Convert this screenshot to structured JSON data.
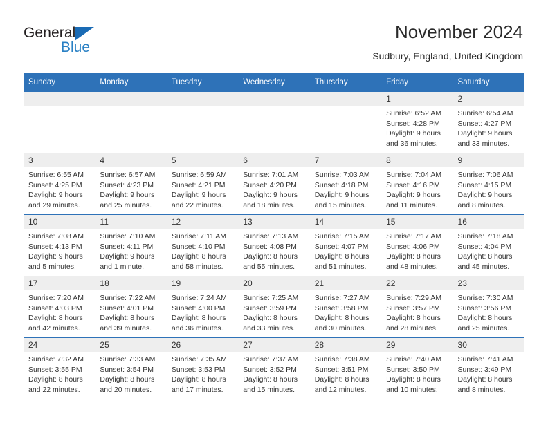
{
  "brand": {
    "name_part1": "General",
    "name_part2": "Blue",
    "triangle_color": "#1a6bb5",
    "blue_text_color": "#2980c4"
  },
  "header": {
    "title": "November 2024",
    "subtitle": "Sudbury, England, United Kingdom"
  },
  "theme": {
    "header_blue": "#2e72b8",
    "daynum_band_gray": "#eeeeee",
    "text_color": "#333333"
  },
  "weekday_headers": [
    "Sunday",
    "Monday",
    "Tuesday",
    "Wednesday",
    "Thursday",
    "Friday",
    "Saturday"
  ],
  "weeks": [
    [
      {
        "day": "",
        "sunrise": "",
        "sunset": "",
        "daylight_line1": "",
        "daylight_line2": "",
        "empty": true
      },
      {
        "day": "",
        "sunrise": "",
        "sunset": "",
        "daylight_line1": "",
        "daylight_line2": "",
        "empty": true
      },
      {
        "day": "",
        "sunrise": "",
        "sunset": "",
        "daylight_line1": "",
        "daylight_line2": "",
        "empty": true
      },
      {
        "day": "",
        "sunrise": "",
        "sunset": "",
        "daylight_line1": "",
        "daylight_line2": "",
        "empty": true
      },
      {
        "day": "",
        "sunrise": "",
        "sunset": "",
        "daylight_line1": "",
        "daylight_line2": "",
        "empty": true
      },
      {
        "day": "1",
        "sunrise": "Sunrise: 6:52 AM",
        "sunset": "Sunset: 4:28 PM",
        "daylight_line1": "Daylight: 9 hours",
        "daylight_line2": "and 36 minutes.",
        "empty": false
      },
      {
        "day": "2",
        "sunrise": "Sunrise: 6:54 AM",
        "sunset": "Sunset: 4:27 PM",
        "daylight_line1": "Daylight: 9 hours",
        "daylight_line2": "and 33 minutes.",
        "empty": false
      }
    ],
    [
      {
        "day": "3",
        "sunrise": "Sunrise: 6:55 AM",
        "sunset": "Sunset: 4:25 PM",
        "daylight_line1": "Daylight: 9 hours",
        "daylight_line2": "and 29 minutes.",
        "empty": false
      },
      {
        "day": "4",
        "sunrise": "Sunrise: 6:57 AM",
        "sunset": "Sunset: 4:23 PM",
        "daylight_line1": "Daylight: 9 hours",
        "daylight_line2": "and 25 minutes.",
        "empty": false
      },
      {
        "day": "5",
        "sunrise": "Sunrise: 6:59 AM",
        "sunset": "Sunset: 4:21 PM",
        "daylight_line1": "Daylight: 9 hours",
        "daylight_line2": "and 22 minutes.",
        "empty": false
      },
      {
        "day": "6",
        "sunrise": "Sunrise: 7:01 AM",
        "sunset": "Sunset: 4:20 PM",
        "daylight_line1": "Daylight: 9 hours",
        "daylight_line2": "and 18 minutes.",
        "empty": false
      },
      {
        "day": "7",
        "sunrise": "Sunrise: 7:03 AM",
        "sunset": "Sunset: 4:18 PM",
        "daylight_line1": "Daylight: 9 hours",
        "daylight_line2": "and 15 minutes.",
        "empty": false
      },
      {
        "day": "8",
        "sunrise": "Sunrise: 7:04 AM",
        "sunset": "Sunset: 4:16 PM",
        "daylight_line1": "Daylight: 9 hours",
        "daylight_line2": "and 11 minutes.",
        "empty": false
      },
      {
        "day": "9",
        "sunrise": "Sunrise: 7:06 AM",
        "sunset": "Sunset: 4:15 PM",
        "daylight_line1": "Daylight: 9 hours",
        "daylight_line2": "and 8 minutes.",
        "empty": false
      }
    ],
    [
      {
        "day": "10",
        "sunrise": "Sunrise: 7:08 AM",
        "sunset": "Sunset: 4:13 PM",
        "daylight_line1": "Daylight: 9 hours",
        "daylight_line2": "and 5 minutes.",
        "empty": false
      },
      {
        "day": "11",
        "sunrise": "Sunrise: 7:10 AM",
        "sunset": "Sunset: 4:11 PM",
        "daylight_line1": "Daylight: 9 hours",
        "daylight_line2": "and 1 minute.",
        "empty": false
      },
      {
        "day": "12",
        "sunrise": "Sunrise: 7:11 AM",
        "sunset": "Sunset: 4:10 PM",
        "daylight_line1": "Daylight: 8 hours",
        "daylight_line2": "and 58 minutes.",
        "empty": false
      },
      {
        "day": "13",
        "sunrise": "Sunrise: 7:13 AM",
        "sunset": "Sunset: 4:08 PM",
        "daylight_line1": "Daylight: 8 hours",
        "daylight_line2": "and 55 minutes.",
        "empty": false
      },
      {
        "day": "14",
        "sunrise": "Sunrise: 7:15 AM",
        "sunset": "Sunset: 4:07 PM",
        "daylight_line1": "Daylight: 8 hours",
        "daylight_line2": "and 51 minutes.",
        "empty": false
      },
      {
        "day": "15",
        "sunrise": "Sunrise: 7:17 AM",
        "sunset": "Sunset: 4:06 PM",
        "daylight_line1": "Daylight: 8 hours",
        "daylight_line2": "and 48 minutes.",
        "empty": false
      },
      {
        "day": "16",
        "sunrise": "Sunrise: 7:18 AM",
        "sunset": "Sunset: 4:04 PM",
        "daylight_line1": "Daylight: 8 hours",
        "daylight_line2": "and 45 minutes.",
        "empty": false
      }
    ],
    [
      {
        "day": "17",
        "sunrise": "Sunrise: 7:20 AM",
        "sunset": "Sunset: 4:03 PM",
        "daylight_line1": "Daylight: 8 hours",
        "daylight_line2": "and 42 minutes.",
        "empty": false
      },
      {
        "day": "18",
        "sunrise": "Sunrise: 7:22 AM",
        "sunset": "Sunset: 4:01 PM",
        "daylight_line1": "Daylight: 8 hours",
        "daylight_line2": "and 39 minutes.",
        "empty": false
      },
      {
        "day": "19",
        "sunrise": "Sunrise: 7:24 AM",
        "sunset": "Sunset: 4:00 PM",
        "daylight_line1": "Daylight: 8 hours",
        "daylight_line2": "and 36 minutes.",
        "empty": false
      },
      {
        "day": "20",
        "sunrise": "Sunrise: 7:25 AM",
        "sunset": "Sunset: 3:59 PM",
        "daylight_line1": "Daylight: 8 hours",
        "daylight_line2": "and 33 minutes.",
        "empty": false
      },
      {
        "day": "21",
        "sunrise": "Sunrise: 7:27 AM",
        "sunset": "Sunset: 3:58 PM",
        "daylight_line1": "Daylight: 8 hours",
        "daylight_line2": "and 30 minutes.",
        "empty": false
      },
      {
        "day": "22",
        "sunrise": "Sunrise: 7:29 AM",
        "sunset": "Sunset: 3:57 PM",
        "daylight_line1": "Daylight: 8 hours",
        "daylight_line2": "and 28 minutes.",
        "empty": false
      },
      {
        "day": "23",
        "sunrise": "Sunrise: 7:30 AM",
        "sunset": "Sunset: 3:56 PM",
        "daylight_line1": "Daylight: 8 hours",
        "daylight_line2": "and 25 minutes.",
        "empty": false
      }
    ],
    [
      {
        "day": "24",
        "sunrise": "Sunrise: 7:32 AM",
        "sunset": "Sunset: 3:55 PM",
        "daylight_line1": "Daylight: 8 hours",
        "daylight_line2": "and 22 minutes.",
        "empty": false
      },
      {
        "day": "25",
        "sunrise": "Sunrise: 7:33 AM",
        "sunset": "Sunset: 3:54 PM",
        "daylight_line1": "Daylight: 8 hours",
        "daylight_line2": "and 20 minutes.",
        "empty": false
      },
      {
        "day": "26",
        "sunrise": "Sunrise: 7:35 AM",
        "sunset": "Sunset: 3:53 PM",
        "daylight_line1": "Daylight: 8 hours",
        "daylight_line2": "and 17 minutes.",
        "empty": false
      },
      {
        "day": "27",
        "sunrise": "Sunrise: 7:37 AM",
        "sunset": "Sunset: 3:52 PM",
        "daylight_line1": "Daylight: 8 hours",
        "daylight_line2": "and 15 minutes.",
        "empty": false
      },
      {
        "day": "28",
        "sunrise": "Sunrise: 7:38 AM",
        "sunset": "Sunset: 3:51 PM",
        "daylight_line1": "Daylight: 8 hours",
        "daylight_line2": "and 12 minutes.",
        "empty": false
      },
      {
        "day": "29",
        "sunrise": "Sunrise: 7:40 AM",
        "sunset": "Sunset: 3:50 PM",
        "daylight_line1": "Daylight: 8 hours",
        "daylight_line2": "and 10 minutes.",
        "empty": false
      },
      {
        "day": "30",
        "sunrise": "Sunrise: 7:41 AM",
        "sunset": "Sunset: 3:49 PM",
        "daylight_line1": "Daylight: 8 hours",
        "daylight_line2": "and 8 minutes.",
        "empty": false
      }
    ]
  ]
}
